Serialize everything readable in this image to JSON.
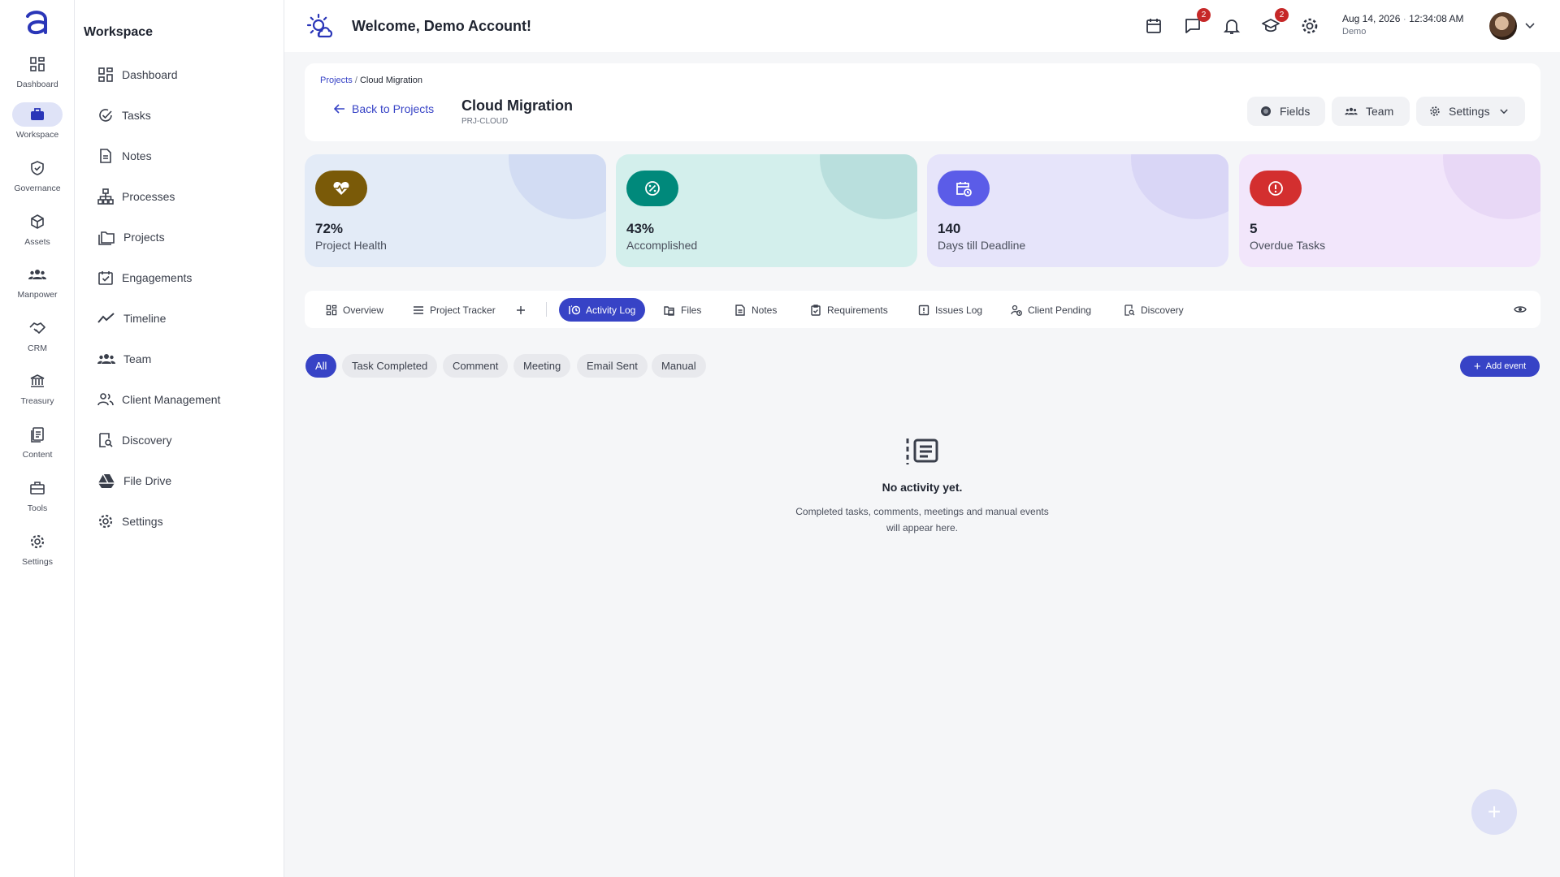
{
  "rail": {
    "items": [
      {
        "label": "Dashboard"
      },
      {
        "label": "Workspace"
      },
      {
        "label": "Governance"
      },
      {
        "label": "Assets"
      },
      {
        "label": "Manpower"
      },
      {
        "label": "CRM"
      },
      {
        "label": "Treasury"
      },
      {
        "label": "Content"
      },
      {
        "label": "Tools"
      },
      {
        "label": "Settings"
      }
    ],
    "active": "Workspace"
  },
  "sidebar": {
    "title": "Workspace",
    "items": [
      {
        "label": "Dashboard"
      },
      {
        "label": "Tasks"
      },
      {
        "label": "Notes"
      },
      {
        "label": "Processes"
      },
      {
        "label": "Projects"
      },
      {
        "label": "Engagements"
      },
      {
        "label": "Timeline"
      },
      {
        "label": "Team"
      },
      {
        "label": "Client Management"
      },
      {
        "label": "Discovery"
      },
      {
        "label": "File Drive"
      },
      {
        "label": "Settings"
      }
    ]
  },
  "header": {
    "welcome": "Welcome, Demo Account!",
    "messages_badge": "2",
    "learning_badge": "2",
    "date": "Aug 14, 2026",
    "time": "12:34:08 AM",
    "user": "Demo"
  },
  "project": {
    "breadcrumb_root": "Projects",
    "breadcrumb_sep": "/",
    "breadcrumb_current": "Cloud Migration",
    "back_label": "Back to Projects",
    "title": "Cloud Migration",
    "code": "PRJ-CLOUD",
    "fields_label": "Fields",
    "team_label": "Team",
    "settings_label": "Settings"
  },
  "kpis": [
    {
      "value": "72%",
      "label": "Project Health",
      "icon": "heart-pulse-icon",
      "bg": "#e3ebf7",
      "icon_bg": "#7a5a08",
      "blob": "#c6d2f0"
    },
    {
      "value": "43%",
      "label": "Accomplished",
      "icon": "percent-badge-icon",
      "bg": "#d3efec",
      "icon_bg": "#00897b",
      "blob": "#a9d4d4"
    },
    {
      "value": "140",
      "label": "Days till Deadline",
      "icon": "calendar-clock-icon",
      "bg": "#e6e4fa",
      "icon_bg": "#5b5ce8",
      "blob": "#d0cdf3"
    },
    {
      "value": "5",
      "label": "Overdue Tasks",
      "icon": "alert-circle-icon",
      "bg": "#f2e6fb",
      "icon_bg": "#d32f2f",
      "blob": "#e1cff3"
    }
  ],
  "tabs": [
    {
      "label": "Overview"
    },
    {
      "label": "Project Tracker"
    },
    {
      "label": "Activity Log"
    },
    {
      "label": "Files"
    },
    {
      "label": "Notes"
    },
    {
      "label": "Requirements"
    },
    {
      "label": "Issues Log"
    },
    {
      "label": "Client Pending"
    },
    {
      "label": "Discovery"
    }
  ],
  "active_tab": "Activity Log",
  "filters": [
    {
      "label": "All"
    },
    {
      "label": "Task Completed"
    },
    {
      "label": "Comment"
    },
    {
      "label": "Meeting"
    },
    {
      "label": "Email Sent"
    },
    {
      "label": "Manual"
    }
  ],
  "active_filter": "All",
  "add_event_label": "Add event",
  "empty": {
    "title": "No activity yet.",
    "line1": "Completed tasks, comments, meetings and manual events",
    "line2": "will appear here."
  },
  "colors": {
    "accent": "#3743c6"
  }
}
